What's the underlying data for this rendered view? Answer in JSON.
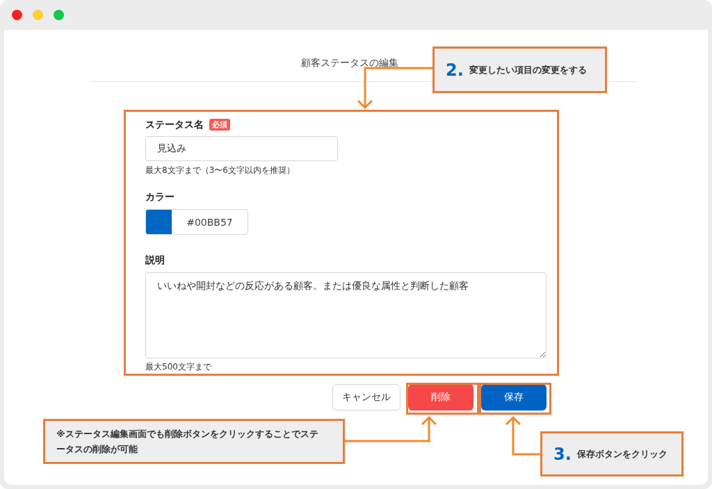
{
  "page": {
    "title": "顧客ステータスの編集"
  },
  "form": {
    "name_field": {
      "label": "ステータス名",
      "badge": "必須",
      "value": "見込み",
      "hint": "最大8文字まで（3〜6文字以内を推奨）"
    },
    "color_field": {
      "label": "カラー",
      "value": "#00BB57",
      "color": "#0066c0"
    },
    "description_field": {
      "label": "説明",
      "value": "いいねや開封などの反応がある顧客。または優良な属性と判断した顧客",
      "hint": "最大500文字まで"
    }
  },
  "buttons": [
    {
      "kind": "cancel",
      "label": "キャンセル"
    },
    {
      "kind": "delete",
      "label": "削除"
    },
    {
      "kind": "save",
      "label": "保存"
    }
  ],
  "annotations": [
    {
      "kind": "step",
      "number": "2.",
      "text": "変更したい項目の変更をする"
    },
    {
      "kind": "note",
      "text": "※ステータス編集画面でも削除ボタンをクリックすることでステータスの削除が可能"
    },
    {
      "kind": "step",
      "number": "3.",
      "text": "保存ボタンをクリック"
    }
  ]
}
